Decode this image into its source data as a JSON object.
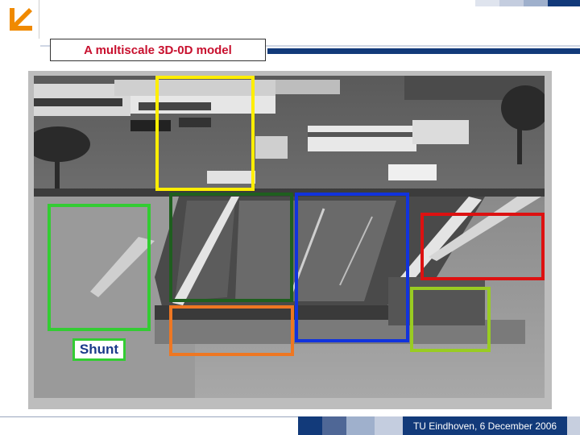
{
  "slide": {
    "title": "A multiscale 3D-0D model",
    "shunt_label": "Shunt",
    "footer": "TU Eindhoven, 6 December 2006"
  },
  "colors": {
    "brand_navy": "#123a7a",
    "logo_orange": "#f08a00",
    "title_red": "#c8102e",
    "box_yellow": "#ffee00",
    "box_green": "#33cc33",
    "box_darkgreen": "#1f5f1f",
    "box_blue": "#1133dd",
    "box_red": "#dd1111",
    "box_orange": "#ee7722",
    "box_lightgreen": "#99cc22"
  },
  "icons": {
    "logo": "arrow-down-left-icon"
  }
}
